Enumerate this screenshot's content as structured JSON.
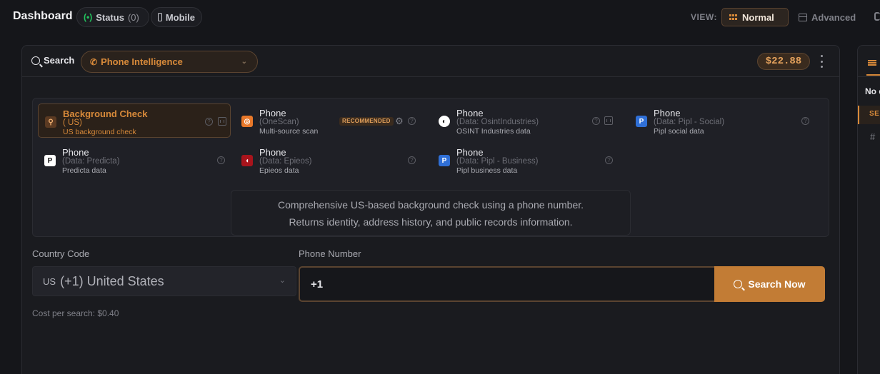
{
  "header": {
    "title": "Dashboard",
    "status_label": "Status",
    "status_count": "(0)",
    "status_icon": "broadcast-icon",
    "mobile_label": "Mobile",
    "view_label": "VIEW:",
    "view_normal": "Normal",
    "view_advanced": "Advanced"
  },
  "search": {
    "label": "Search",
    "type_value": "Phone Intelligence",
    "balance": "$22.88"
  },
  "providers": [
    {
      "title": "Background Check",
      "sub": "( US)",
      "desc": "US background check",
      "selected": true,
      "icon": "background-check-icon"
    },
    {
      "title": "Phone",
      "sub": "(OneScan)",
      "desc": "Multi-source scan",
      "badge": "RECOMMENDED",
      "icon": "onescan-icon"
    },
    {
      "title": "Phone",
      "sub": "(Data: OsintIndustries)",
      "desc": "OSINT Industries data",
      "icon": "osint-industries-icon"
    },
    {
      "title": "Phone",
      "sub": "(Data: Pipl - Social)",
      "desc": "Pipl social data",
      "icon": "pipl-icon"
    },
    {
      "title": "Phone",
      "sub": "(Data: Predicta)",
      "desc": "Predicta data",
      "icon": "predicta-icon"
    },
    {
      "title": "Phone",
      "sub": "(Data: Epieos)",
      "desc": "Epieos data",
      "icon": "epieos-icon"
    },
    {
      "title": "Phone",
      "sub": "(Data: Pipl - Business)",
      "desc": "Pipl business data",
      "icon": "pipl-icon"
    }
  ],
  "description": {
    "line1": "Comprehensive US-based background check using a phone number.",
    "line2": "Returns identity, address history, and public records information."
  },
  "form": {
    "country_label": "Country Code",
    "country_code": "US",
    "country_value": "(+1) United States",
    "phone_label": "Phone Number",
    "phone_value": "+1",
    "search_button": "Search Now",
    "cost": "Cost per search: $0.40"
  },
  "side": {
    "no_data": "No data",
    "section": "SE",
    "hash": "#"
  },
  "colors": {
    "accent": "#c27c35",
    "status_green": "#22c55e"
  }
}
